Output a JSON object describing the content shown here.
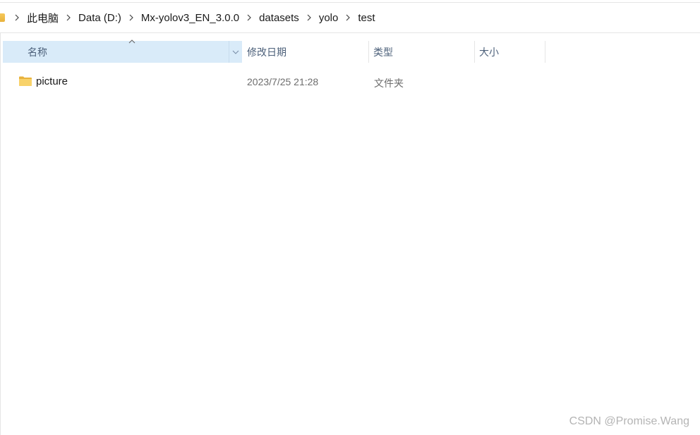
{
  "breadcrumb": {
    "items": [
      "此电脑",
      "Data (D:)",
      "Mx-yolov3_EN_3.0.0",
      "datasets",
      "yolo",
      "test"
    ]
  },
  "columns": {
    "name": "名称",
    "date_modified": "修改日期",
    "type": "类型",
    "size": "大小"
  },
  "files": [
    {
      "name": "picture",
      "date_modified": "2023/7/25 21:28",
      "type": "文件夹",
      "size": ""
    }
  ],
  "sort": {
    "column": "name",
    "direction": "ascending"
  },
  "icons": {
    "folder": "folder-icon",
    "separator": "chevron-right-icon",
    "sort": "sort-ascending-icon",
    "dropdown": "chevron-down-icon"
  },
  "colors": {
    "header_selected_bg": "#d9ebf9",
    "header_text": "#4c607a",
    "folder": "#f6c85a"
  },
  "watermark": "CSDN @Promise.Wang"
}
